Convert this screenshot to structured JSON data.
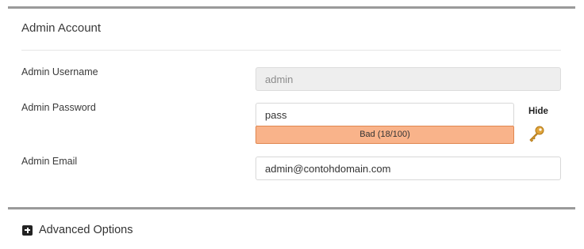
{
  "section": {
    "title": "Admin Account"
  },
  "fields": {
    "username": {
      "label": "Admin Username",
      "value": "admin"
    },
    "password": {
      "label": "Admin Password",
      "value": "pass",
      "toggle_label": "Hide"
    },
    "strength": {
      "text": "Bad (18/100)",
      "score": 18,
      "max": 100,
      "color": "#f9b38a"
    },
    "email": {
      "label": "Admin Email",
      "value": "admin@contohdomain.com"
    }
  },
  "advanced": {
    "label": "Advanced Options"
  },
  "icons": {
    "key": "key-icon",
    "expand": "plus-square-icon"
  }
}
